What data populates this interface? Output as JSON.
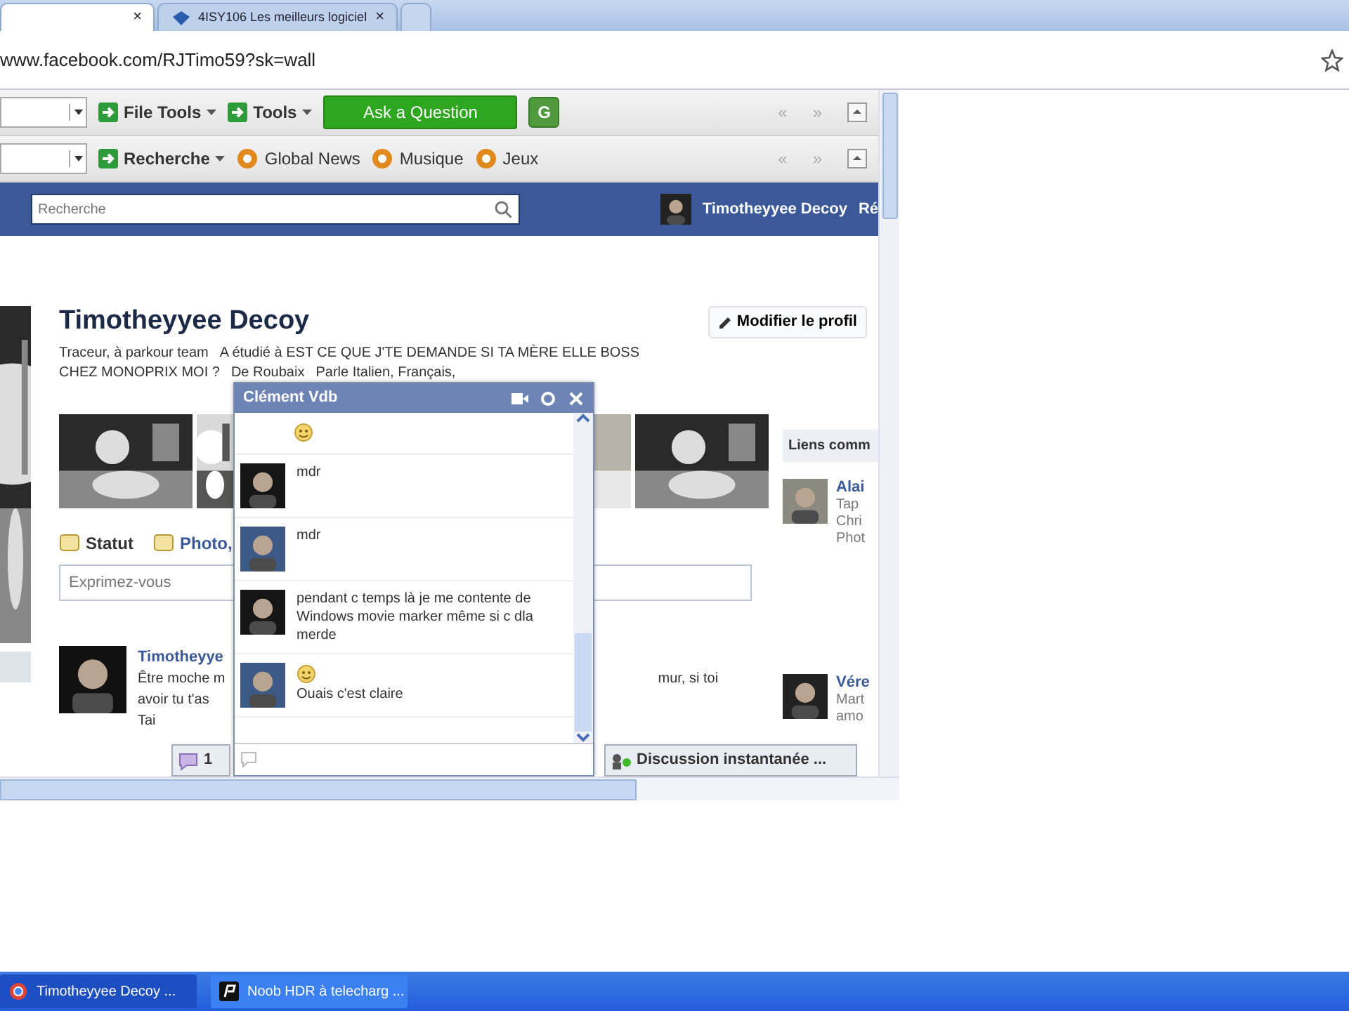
{
  "browser": {
    "tabs": [
      {
        "selected": true,
        "close": "×"
      },
      {
        "selected": false,
        "title": "4ISY106 Les meilleurs logiciel",
        "close": "×"
      }
    ],
    "address": "www.facebook.com/RJTimo59?sk=wall"
  },
  "toolbar_1": {
    "items": [
      {
        "kind": "combo"
      },
      {
        "kind": "menu",
        "label": "File Tools"
      },
      {
        "kind": "menu",
        "label": "Tools"
      },
      {
        "kind": "ask",
        "label": "Ask a Question"
      },
      {
        "kind": "g",
        "label": "G"
      }
    ],
    "nav": [
      "«",
      "»"
    ]
  },
  "toolbar_2": {
    "items": [
      {
        "kind": "combo"
      },
      {
        "kind": "menu",
        "label": "Recherche"
      },
      {
        "kind": "link",
        "label": "Global News"
      },
      {
        "kind": "link",
        "label": "Musique"
      },
      {
        "kind": "link",
        "label": "Jeux"
      }
    ],
    "nav": [
      "«",
      "»"
    ]
  },
  "facebook_bar": {
    "search_placeholder": "Recherche",
    "user": "Timotheyyee Decoy",
    "cut_link": "Ré"
  },
  "profile": {
    "name": "Timotheyyee Decoy",
    "edit_button": "Modifier le profil",
    "info": [
      "Traceur, à parkour team",
      "A étudié à EST CE QUE J'TE DEMANDE SI TA MÈRE ELLE BOSS",
      "CHEZ MONOPRIX MOI ?",
      "De Roubaix",
      "Parle Italien, Français,"
    ]
  },
  "composer": {
    "tabs": [
      {
        "label": "Statut",
        "selected": true
      },
      {
        "label": "Photo,",
        "selected": false
      }
    ],
    "placeholder": "Exprimez-vous"
  },
  "post": {
    "name": "Timotheyye",
    "lines": [
      "Être moche m",
      "avoir tu t'as",
      "Tai"
    ],
    "right_text": "mur, si toi"
  },
  "sidebar": {
    "title": "Liens comm",
    "items": [
      {
        "name": "Alai",
        "lines": [
          "Tap",
          "Chri",
          "Phot"
        ]
      },
      {
        "name": "Vére",
        "lines": [
          "Mart",
          "amo"
        ]
      }
    ]
  },
  "chat": {
    "title": "Clément Vdb",
    "messages": [
      {
        "kind": "continued",
        "smiley": true
      },
      {
        "kind": "own",
        "smiley": false,
        "text": "mdr"
      },
      {
        "kind": "friend",
        "smiley": false,
        "text": "mdr"
      },
      {
        "kind": "own",
        "smiley": false,
        "text": "pendant c temps là je me contente de Windows movie marker même si c dla merde"
      },
      {
        "kind": "friend",
        "smiley": true,
        "text": "Ouais c'est claire"
      }
    ]
  },
  "notification_count": "1",
  "chat_bar": "Discussion instantanée ...",
  "taskbar": [
    {
      "label": "Timotheyyee Decoy ...",
      "selected": true
    },
    {
      "label": "Noob HDR à telecharg ...",
      "selected": false
    }
  ]
}
